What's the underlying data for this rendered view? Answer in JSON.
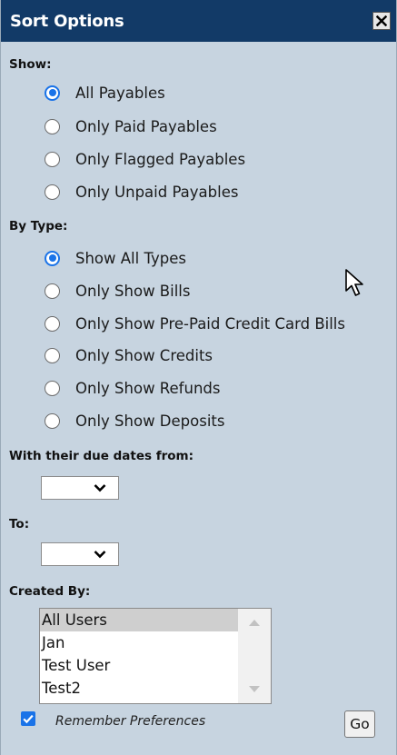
{
  "window": {
    "title": "Sort Options",
    "close_icon": "close-x-icon"
  },
  "show": {
    "label": "Show:",
    "options": [
      "All Payables",
      "Only Paid Payables",
      "Only Flagged Payables",
      "Only Unpaid Payables"
    ],
    "selected": "All Payables"
  },
  "by_type": {
    "label": "By Type:",
    "options": [
      "Show All Types",
      "Only Show Bills",
      "Only Show Pre-Paid Credit Card Bills",
      "Only Show Credits",
      "Only Show Refunds",
      "Only Show Deposits"
    ],
    "selected": "Show All Types"
  },
  "due_dates": {
    "from_label": "With their due dates from:",
    "from_value": "",
    "to_label": "To:",
    "to_value": ""
  },
  "created_by": {
    "label": "Created By:",
    "items": [
      "All Users",
      "Jan",
      "Test User",
      "Test2"
    ],
    "selected": "All Users"
  },
  "remember": {
    "label": "Remember Preferences",
    "checked": true
  },
  "go_button": {
    "label": "Go"
  },
  "colors": {
    "panel_bg": "#c7d4e0",
    "titlebar_bg": "#123a67",
    "accent": "#1a73e8"
  }
}
